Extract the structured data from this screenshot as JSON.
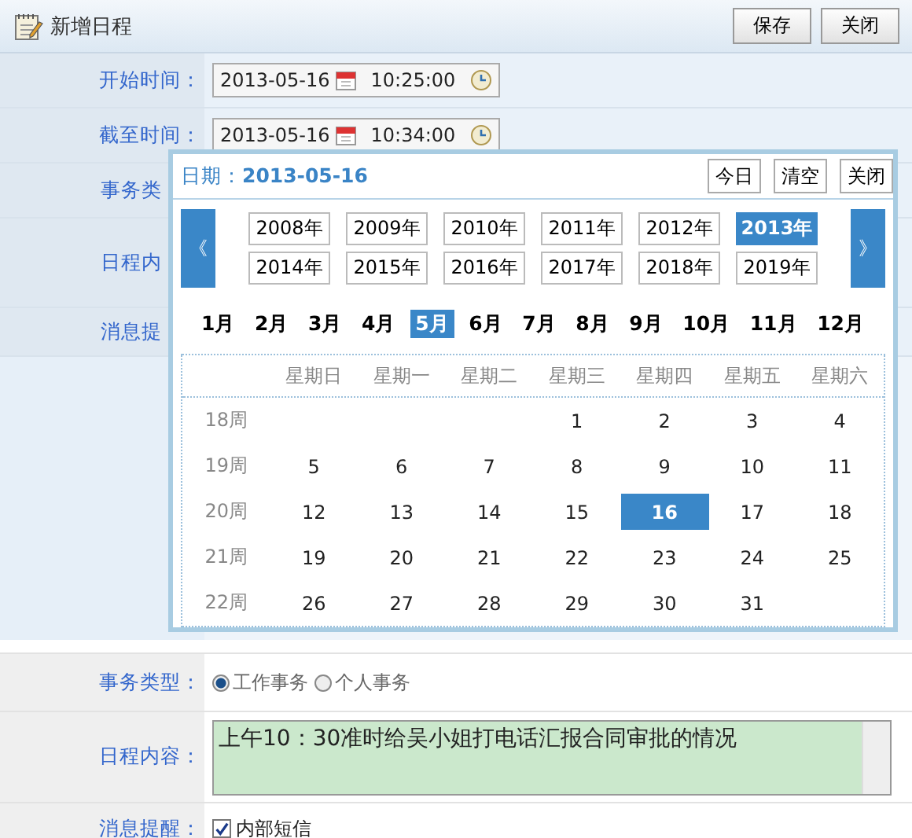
{
  "window": {
    "title": "新增日程"
  },
  "buttons": [
    "保存",
    "关闭"
  ],
  "form_behind": [
    {
      "label": "开始时间：",
      "kind": "datetime",
      "date": "2013-05-16",
      "time": "10:25:00"
    },
    {
      "label": "截至时间：",
      "kind": "datetime",
      "date": "2013-05-16",
      "time": "10:34:00"
    },
    {
      "label": "事务类",
      "kind": "covered"
    },
    {
      "label": "日程内",
      "kind": "covered"
    },
    {
      "label": "消息提",
      "kind": "covered"
    }
  ],
  "date_picker": {
    "label": "日期：",
    "date": "2013-05-16",
    "buttons": [
      "今日",
      "清空",
      "关闭"
    ],
    "prev": "《",
    "next": "》",
    "years": [
      {
        "label": "2008年",
        "selected": false
      },
      {
        "label": "2009年",
        "selected": false
      },
      {
        "label": "2010年",
        "selected": false
      },
      {
        "label": "2011年",
        "selected": false
      },
      {
        "label": "2012年",
        "selected": false
      },
      {
        "label": "2013年",
        "selected": true
      },
      {
        "label": "2014年",
        "selected": false
      },
      {
        "label": "2015年",
        "selected": false
      },
      {
        "label": "2016年",
        "selected": false
      },
      {
        "label": "2017年",
        "selected": false
      },
      {
        "label": "2018年",
        "selected": false
      },
      {
        "label": "2019年",
        "selected": false
      }
    ],
    "months": [
      {
        "label": "1月",
        "selected": false
      },
      {
        "label": "2月",
        "selected": false
      },
      {
        "label": "3月",
        "selected": false
      },
      {
        "label": "4月",
        "selected": false
      },
      {
        "label": "5月",
        "selected": true
      },
      {
        "label": "6月",
        "selected": false
      },
      {
        "label": "7月",
        "selected": false
      },
      {
        "label": "8月",
        "selected": false
      },
      {
        "label": "9月",
        "selected": false
      },
      {
        "label": "10月",
        "selected": false
      },
      {
        "label": "11月",
        "selected": false
      },
      {
        "label": "12月",
        "selected": false
      }
    ],
    "weekdays": [
      "星期日",
      "星期一",
      "星期二",
      "星期三",
      "星期四",
      "星期五",
      "星期六"
    ],
    "weeks": [
      {
        "label": "18周",
        "leading_gap": true,
        "days": [
          {
            "day": "1",
            "selected": false
          },
          {
            "day": "2",
            "selected": false
          },
          {
            "day": "3",
            "selected": false
          },
          {
            "day": "4",
            "selected": false
          }
        ]
      },
      {
        "label": "19周",
        "days": [
          {
            "day": "5",
            "selected": false
          },
          {
            "day": "6",
            "selected": false
          },
          {
            "day": "7",
            "selected": false
          },
          {
            "day": "8",
            "selected": false
          },
          {
            "day": "9",
            "selected": false
          },
          {
            "day": "10",
            "selected": false
          },
          {
            "day": "11",
            "selected": false
          }
        ]
      },
      {
        "label": "20周",
        "days": [
          {
            "day": "12",
            "selected": false
          },
          {
            "day": "13",
            "selected": false
          },
          {
            "day": "14",
            "selected": false
          },
          {
            "day": "15",
            "selected": false
          },
          {
            "day": "16",
            "selected": true
          },
          {
            "day": "17",
            "selected": false
          },
          {
            "day": "18",
            "selected": false
          }
        ]
      },
      {
        "label": "21周",
        "days": [
          {
            "day": "19",
            "selected": false
          },
          {
            "day": "20",
            "selected": false
          },
          {
            "day": "21",
            "selected": false
          },
          {
            "day": "22",
            "selected": false
          },
          {
            "day": "23",
            "selected": false
          },
          {
            "day": "24",
            "selected": false
          },
          {
            "day": "25",
            "selected": false
          }
        ]
      },
      {
        "label": "22周",
        "leading_gap": false,
        "days": [
          {
            "day": "26",
            "selected": false
          },
          {
            "day": "27",
            "selected": false
          },
          {
            "day": "28",
            "selected": false
          },
          {
            "day": "29",
            "selected": false
          },
          {
            "day": "30",
            "selected": false
          },
          {
            "day": "31",
            "selected": false
          }
        ]
      }
    ]
  },
  "form": {
    "type": {
      "label": "事务类型：",
      "options": [
        {
          "label": "工作事务",
          "selected": true
        },
        {
          "label": "个人事务",
          "selected": false
        }
      ]
    },
    "content": {
      "label": "日程内容：",
      "value": "上午10：30准时给吴小姐打电话汇报合同审批的情况"
    },
    "reminder": {
      "label": "消息提醒：",
      "option": {
        "label": "内部短信",
        "checked": true
      }
    }
  }
}
